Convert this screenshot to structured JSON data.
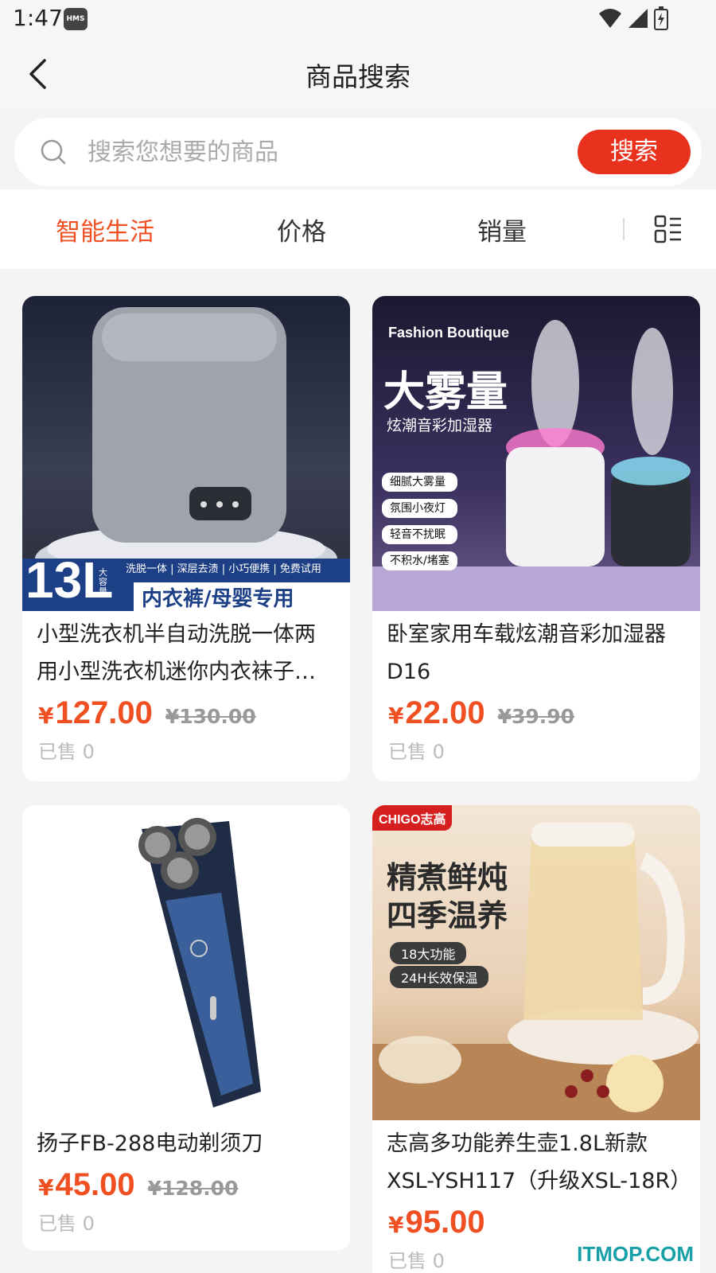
{
  "status": {
    "time": "1:47",
    "badge": "HMS"
  },
  "header": {
    "title": "商品搜索"
  },
  "search": {
    "placeholder": "搜索您想要的商品",
    "button_label": "搜索"
  },
  "sort": {
    "tabs": [
      {
        "label": "智能生活",
        "active": true
      },
      {
        "label": "价格",
        "active": false
      },
      {
        "label": "销量",
        "active": false
      }
    ]
  },
  "products": [
    {
      "title": "小型洗衣机半自动洗脱一体两用小型洗衣机迷你内衣袜子…",
      "price_symbol": "¥",
      "price": "127.00",
      "original_price": "¥130.00",
      "sold": "已售 0",
      "image_text": {
        "capacity": "13L",
        "capacity_sub": "大容量",
        "features": "洗脱一体 | 深层去渍 | 小巧便携 | 免费试用",
        "banner": "内衣裤/母婴专用"
      }
    },
    {
      "title": "卧室家用车载炫潮音彩加湿器D16",
      "price_symbol": "¥",
      "price": "22.00",
      "original_price": "¥39.90",
      "sold": "已售 0",
      "image_text": {
        "brand": "Fashion Boutique",
        "headline": "大雾量",
        "subline": "炫潮音彩加湿器",
        "checks": [
          "细腻大雾量",
          "氛围小夜灯",
          "轻音不扰眠",
          "不积水/堵塞"
        ]
      }
    },
    {
      "title": "扬子FB-288电动剃须刀",
      "price_symbol": "¥",
      "price": "45.00",
      "original_price": "¥128.00",
      "sold": "已售 0",
      "image_text": {}
    },
    {
      "title": "志高多功能养生壶1.8L新款XSL-YSH117（升级XSL-18R）",
      "price_symbol": "¥",
      "price": "95.00",
      "original_price": "",
      "sold": "已售 0",
      "image_text": {
        "brand": "CHIGO志高",
        "headline1": "精煮鲜炖",
        "headline2": "四季温养",
        "tag1": "18大功能",
        "tag2": "24H长效保温"
      }
    }
  ],
  "watermark": "ITMOP.COM",
  "colors": {
    "accent": "#f04f22",
    "search_button": "#e8321e"
  }
}
